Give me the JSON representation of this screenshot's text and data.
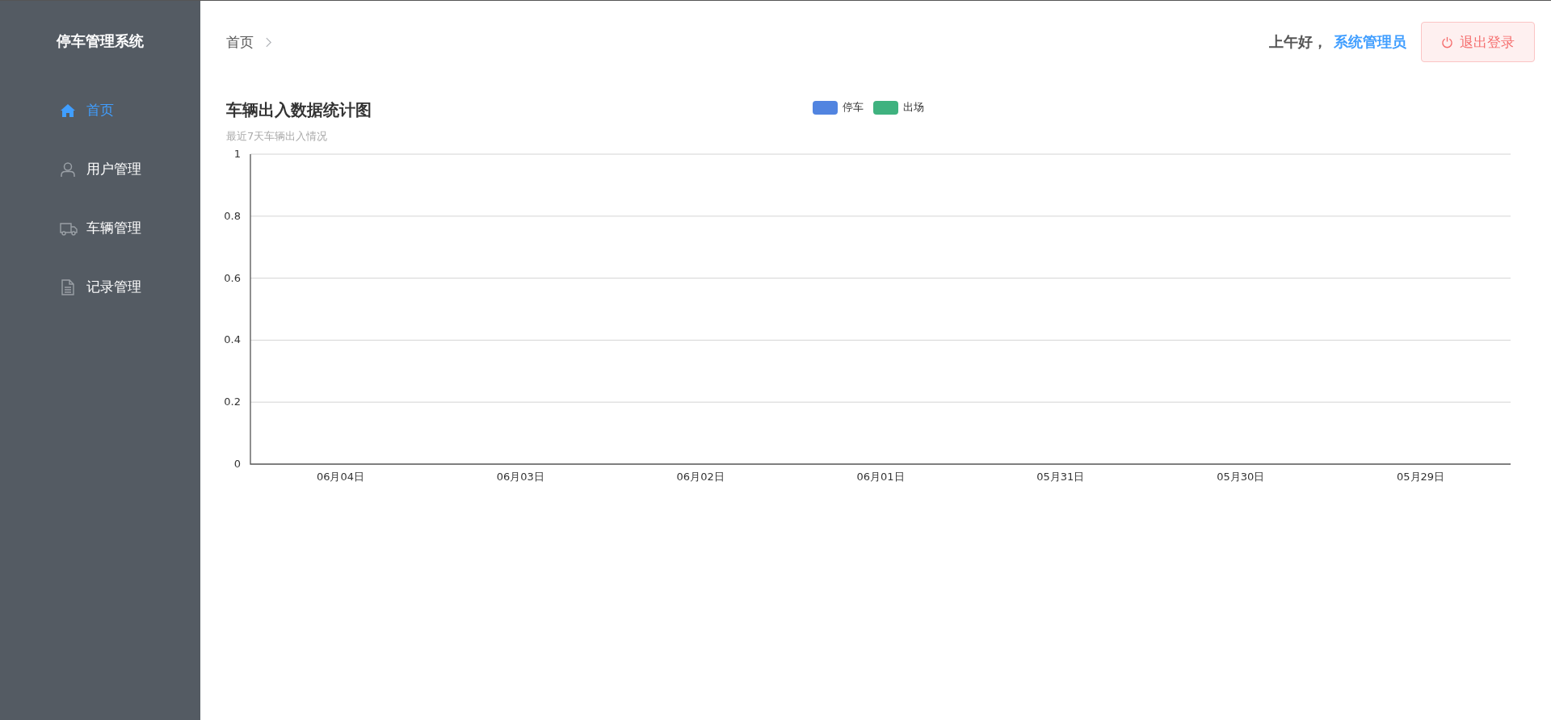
{
  "sidebar": {
    "title": "停车管理系统",
    "items": [
      {
        "label": "首页",
        "selected": true
      },
      {
        "label": "用户管理",
        "selected": false
      },
      {
        "label": "车辆管理",
        "selected": false
      },
      {
        "label": "记录管理",
        "selected": false
      }
    ]
  },
  "header": {
    "breadcrumb": [
      "首页"
    ],
    "greeting": "上午好，",
    "user": "系统管理员",
    "logout_button": "退出登录"
  },
  "chart_panel": {
    "title": "车辆出入数据统计图",
    "subtitle": "最近7天车辆出入情况",
    "chart_data": {
      "type": "bar",
      "categories": [
        "06月04日",
        "06月03日",
        "06月02日",
        "06月01日",
        "05月31日",
        "05月30日",
        "05月29日"
      ],
      "series": [
        {
          "name": "停车",
          "color": "#5184e0",
          "values": [
            0,
            0,
            0,
            0,
            0,
            0,
            0
          ]
        },
        {
          "name": "出场",
          "color": "#3fb27f",
          "values": [
            0,
            0,
            0,
            0,
            0,
            0,
            0
          ]
        }
      ],
      "ylim": [
        0,
        1
      ],
      "grid": true,
      "yticks": [
        0,
        0.2,
        0.4,
        0.6,
        0.8,
        1
      ]
    }
  }
}
